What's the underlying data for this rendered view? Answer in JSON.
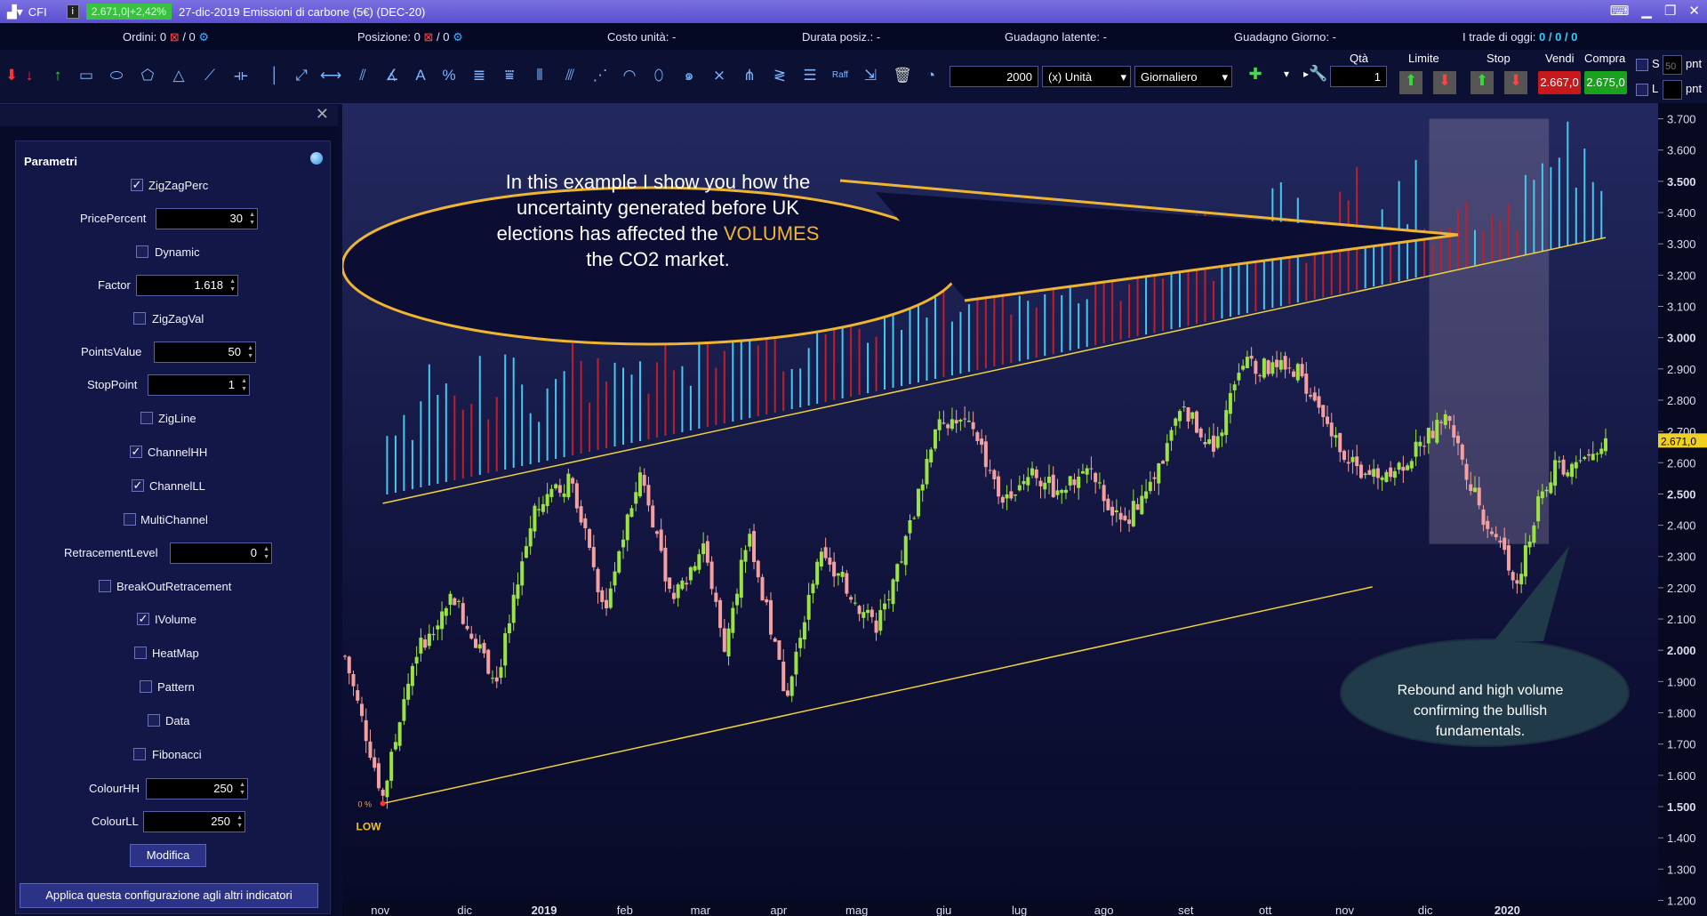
{
  "titlebar": {
    "symbol": "CFI",
    "price_badge": "2.671,0|+2,42%",
    "title": "27-dic-2019 Emissioni di carbone (5€) (DEC-20)"
  },
  "status": {
    "ordini_label": "Ordini:",
    "ordini_value": "0",
    "ordini_total": "/ 0",
    "posizione_label": "Posizione:",
    "posizione_value": "0",
    "posizione_total": "/ 0",
    "costo_unita": "Costo unità: -",
    "durata_posiz": "Durata posiz.: -",
    "guadagno_latente": "Guadagno latente: -",
    "guadagno_giorno": "Guadagno Giorno: -",
    "trade_oggi_label": "I trade di oggi:",
    "trade_oggi_value": "0 / 0 / 0"
  },
  "toolbar": {
    "quantity": "2000",
    "unit": "(x) Unità",
    "period": "Giornaliero",
    "raff_label": "Raff",
    "qta_label": "Qtà",
    "qta_value": "1",
    "limite_label": "Limite",
    "stop_label": "Stop",
    "vendi_label": "Vendi",
    "vendi_price": "2.667,0",
    "compra_label": "Compra",
    "compra_price": "2.675,0",
    "s_label": "S",
    "l_label": "L",
    "pnt_value": "50",
    "pnt_label": "pnt",
    "pnt_label2": "pnt"
  },
  "panel": {
    "title": "Parametri",
    "params": [
      {
        "label": "ZigZagPerc",
        "type": "check",
        "checked": true
      },
      {
        "label": "PricePercent",
        "type": "num",
        "value": "30"
      },
      {
        "label": "Dynamic",
        "type": "check",
        "checked": false
      },
      {
        "label": "Factor",
        "type": "num",
        "value": "1.618"
      },
      {
        "label": "ZigZagVal",
        "type": "check",
        "checked": false
      },
      {
        "label": "PointsValue",
        "type": "num",
        "value": "50"
      },
      {
        "label": "StopPoint",
        "type": "num",
        "value": "1"
      },
      {
        "label": "ZigLine",
        "type": "check",
        "checked": false
      },
      {
        "label": "ChannelHH",
        "type": "check",
        "checked": true
      },
      {
        "label": "ChannelLL",
        "type": "check",
        "checked": true
      },
      {
        "label": "MultiChannel",
        "type": "check",
        "checked": false
      },
      {
        "label": "RetracementLevel",
        "type": "num",
        "value": "0"
      },
      {
        "label": "BreakOutRetracement",
        "type": "check",
        "checked": false
      },
      {
        "label": "IVolume",
        "type": "check",
        "checked": true
      },
      {
        "label": "HeatMap",
        "type": "check",
        "checked": false
      },
      {
        "label": "Pattern",
        "type": "check",
        "checked": false
      },
      {
        "label": "Data",
        "type": "check",
        "checked": false
      },
      {
        "label": "Fibonacci",
        "type": "check",
        "checked": false
      },
      {
        "label": "ColourHH",
        "type": "num",
        "value": "250"
      },
      {
        "label": "ColourLL",
        "type": "num",
        "value": "250"
      }
    ],
    "modify_button": "Modifica",
    "apply_button": "Applica questa configurazione agli altri indicatori"
  },
  "chart": {
    "bubble1_line1": "In this example I show you how the",
    "bubble1_line2": "uncertainty generated before UK",
    "bubble1_line3a": "elections has affected the",
    "bubble1_line3b": "VOLUMES",
    "bubble1_line4": "the CO2 market.",
    "bubble2_line1": "Rebound and high volume",
    "bubble2_line2": "confirming the bullish",
    "bubble2_line3": "fundamentals.",
    "low_label": "LOW",
    "zero_pct": "0 %",
    "last_price": "2.671,0"
  },
  "chart_data": {
    "type": "candlestick",
    "y_ticks": [
      "3.700",
      "3.600",
      "3.500",
      "3.400",
      "3.300",
      "3.200",
      "3.100",
      "3.000",
      "2.900",
      "2.800",
      "2.700",
      "2.600",
      "2.500",
      "2.400",
      "2.300",
      "2.200",
      "2.100",
      "2.000",
      "1.900",
      "1.800",
      "1.700",
      "1.600",
      "1.500",
      "1.400",
      "1.300",
      "1.200"
    ],
    "ylim": [
      1.15,
      3.75
    ],
    "x_ticks": [
      "nov",
      "dic",
      "2019",
      "feb",
      "mar",
      "apr",
      "mag",
      "giu",
      "lug",
      "ago",
      "set",
      "ott",
      "nov",
      "dic",
      "2020"
    ],
    "x_ticks_bold": [
      "2019",
      "2020"
    ],
    "close_anchors": [
      [
        0,
        1.98
      ],
      [
        0.03,
        1.53
      ],
      [
        0.055,
        1.98
      ],
      [
        0.085,
        2.18
      ],
      [
        0.12,
        1.9
      ],
      [
        0.15,
        2.45
      ],
      [
        0.18,
        2.55
      ],
      [
        0.205,
        2.12
      ],
      [
        0.235,
        2.58
      ],
      [
        0.26,
        2.15
      ],
      [
        0.285,
        2.35
      ],
      [
        0.3,
        2.0
      ],
      [
        0.32,
        2.38
      ],
      [
        0.35,
        1.85
      ],
      [
        0.375,
        2.3
      ],
      [
        0.395,
        2.22
      ],
      [
        0.42,
        2.07
      ],
      [
        0.435,
        2.2
      ],
      [
        0.455,
        2.5
      ],
      [
        0.47,
        2.75
      ],
      [
        0.5,
        2.7
      ],
      [
        0.52,
        2.48
      ],
      [
        0.545,
        2.58
      ],
      [
        0.565,
        2.5
      ],
      [
        0.59,
        2.58
      ],
      [
        0.615,
        2.4
      ],
      [
        0.64,
        2.52
      ],
      [
        0.665,
        2.78
      ],
      [
        0.69,
        2.63
      ],
      [
        0.71,
        2.92
      ],
      [
        0.735,
        2.9
      ],
      [
        0.755,
        2.9
      ],
      [
        0.78,
        2.7
      ],
      [
        0.81,
        2.55
      ],
      [
        0.84,
        2.6
      ],
      [
        0.875,
        2.75
      ],
      [
        0.9,
        2.45
      ],
      [
        0.92,
        2.3
      ],
      [
        0.93,
        2.22
      ],
      [
        0.945,
        2.45
      ],
      [
        0.96,
        2.58
      ],
      [
        0.98,
        2.6
      ],
      [
        1.0,
        2.67
      ]
    ],
    "volume_note": "volume bars rising along upper channel line",
    "upper_channel": [
      [
        0,
        2.47
      ],
      [
        1,
        3.32
      ]
    ],
    "lower_channel": [
      [
        0,
        1.51
      ],
      [
        1,
        2.36
      ]
    ],
    "highlight_zone": {
      "x": [
        0.86,
        0.955
      ],
      "y": [
        2.34,
        3.7
      ]
    },
    "colors": {
      "up": "#9be342",
      "down": "#f5a0a0",
      "vol_up": "#44c8f0",
      "vol_down": "#c11e2b",
      "channel": "#f0d23a",
      "bubble_border": "#f0b530"
    }
  }
}
